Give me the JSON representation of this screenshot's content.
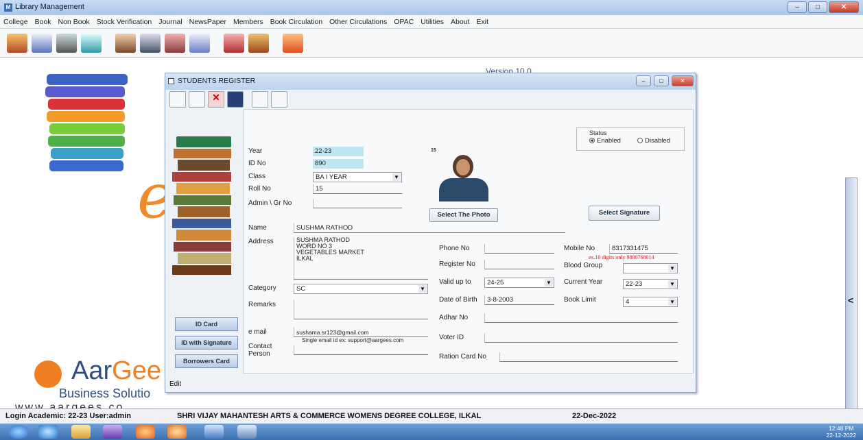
{
  "window": {
    "title": "Library Management"
  },
  "menu": [
    "College",
    "Book",
    "Non Book",
    "Stock Verification",
    "Journal",
    "NewsPaper",
    "Members",
    "Book Circulation",
    "Other Circulations",
    "OPAC",
    "Utilities",
    "About",
    "Exit"
  ],
  "desktop": {
    "version": "Version 10.0",
    "brand1": "Aar",
    "brand2": "Gee",
    "brand_tagline": "Business Solutio",
    "brand_url": "www.aargees.co"
  },
  "dialog": {
    "title": "STUDENTS REGISTER",
    "status": {
      "label": "Status",
      "enabled": "Enabled",
      "disabled": "Disabled",
      "selected": "Enabled"
    },
    "photo_no": "15",
    "fields": {
      "year_label": "Year",
      "year": "22-23",
      "idno_label": "ID No",
      "idno": "890",
      "class_label": "Class",
      "class": "BA I YEAR",
      "roll_label": "Roll No",
      "roll": "15",
      "admin_label": "Admin \\ Gr No",
      "admin": "",
      "name_label": "Name",
      "name": "SUSHMA RATHOD",
      "address_label": "Address",
      "address": [
        "SUSHMA RATHOD",
        "WORD NO 3",
        "VEGETABLES MARKET",
        "ILKAL"
      ],
      "category_label": "Category",
      "category": "SC",
      "remarks_label": "Remarks",
      "email_label": "e mail",
      "email": "sushama.sr123@gmail.com",
      "email_hint": "Single email id ex: support@aargees.com",
      "contact_label1": "Contact",
      "contact_label2": "Person",
      "phone_label": "Phone No",
      "register_label": "Register No",
      "valid_label": "Valid up to",
      "valid": "24-25",
      "dob_label": "Date of Birth",
      "dob": "3-8-2003",
      "adhar_label": "Adhar No",
      "voter_label": "Voter ID",
      "ration_label": "Ration Card No",
      "mobile_label": "Mobile No",
      "mobile": "8317331475",
      "mobile_hint": "ex.10 digits only 9880768014",
      "blood_label": "Blood Group",
      "curyear_label": "Current Year",
      "curyear": "22-23",
      "limit_label": "Book Limit",
      "limit": "4"
    },
    "buttons": {
      "select_photo": "Select The Photo",
      "select_signature": "Select Signature",
      "id_card": "ID Card",
      "id_signature": "ID with Signature",
      "borrowers": "Borrowers Card"
    },
    "mode": "Edit"
  },
  "statusbar": {
    "login": "Login Academic: 22-23 User:admin",
    "college": "SHRI VIJAY MAHANTESH ARTS & COMMERCE WOMENS DEGREE COLLEGE, ILKAL",
    "date": "22-Dec-2022"
  },
  "taskbar": {
    "time": "12:48 PM",
    "date": "22-12-2022"
  }
}
